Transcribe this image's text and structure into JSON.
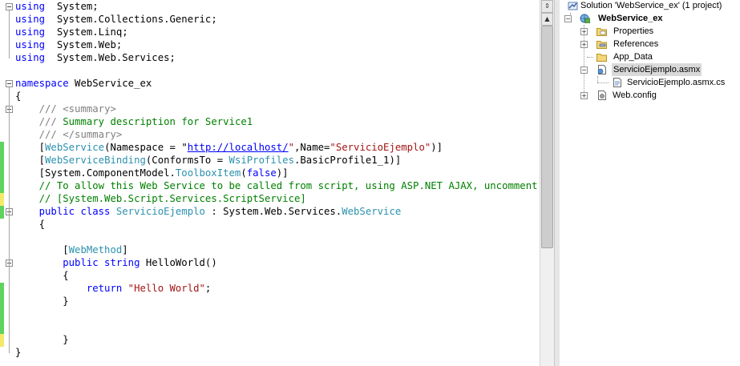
{
  "editor": {
    "lines": [
      [
        [
          "kw",
          "using"
        ],
        [
          "",
          "  System;"
        ]
      ],
      [
        [
          "kw",
          "using"
        ],
        [
          "",
          "  System.Collections.Generic;"
        ]
      ],
      [
        [
          "kw",
          "using"
        ],
        [
          "",
          "  System.Linq;"
        ]
      ],
      [
        [
          "kw",
          "using"
        ],
        [
          "",
          "  System.Web;"
        ]
      ],
      [
        [
          "kw",
          "using"
        ],
        [
          "",
          "  System.Web.Services;"
        ]
      ],
      [],
      [
        [
          "kw",
          "namespace"
        ],
        [
          "",
          " WebService_ex"
        ]
      ],
      [
        [
          "",
          "{"
        ]
      ],
      [
        [
          "",
          "    "
        ],
        [
          "cg",
          "///"
        ],
        [
          "cm",
          " "
        ],
        [
          "cg",
          "<summary>"
        ]
      ],
      [
        [
          "",
          "    "
        ],
        [
          "cg",
          "///"
        ],
        [
          "cm",
          " Summary description for Service1"
        ]
      ],
      [
        [
          "",
          "    "
        ],
        [
          "cg",
          "///"
        ],
        [
          "cm",
          " "
        ],
        [
          "cg",
          "</summary>"
        ]
      ],
      [
        [
          "",
          "    ["
        ],
        [
          "ty",
          "WebService"
        ],
        [
          "",
          "(Namespace = \""
        ],
        [
          "ul",
          "http://localhost/"
        ],
        [
          "st",
          "\""
        ],
        [
          "",
          ",Name="
        ],
        [
          "st",
          "\"ServicioEjemplo\""
        ],
        [
          "",
          ")]"
        ]
      ],
      [
        [
          "",
          "    ["
        ],
        [
          "ty",
          "WebServiceBinding"
        ],
        [
          "",
          "(ConformsTo = "
        ],
        [
          "ty",
          "WsiProfiles"
        ],
        [
          "",
          ".BasicProfile1_1)]"
        ]
      ],
      [
        [
          "",
          "    [System.ComponentModel."
        ],
        [
          "ty",
          "ToolboxItem"
        ],
        [
          "",
          "("
        ],
        [
          "kw",
          "false"
        ],
        [
          "",
          ")]"
        ]
      ],
      [
        [
          "",
          "    "
        ],
        [
          "cm",
          "// To allow this Web Service to be called from script, using ASP.NET AJAX, uncomment the f"
        ]
      ],
      [
        [
          "",
          "    "
        ],
        [
          "cm",
          "// [System.Web.Script.Services.ScriptService]"
        ]
      ],
      [
        [
          "",
          "    "
        ],
        [
          "kw",
          "public class"
        ],
        [
          "",
          " "
        ],
        [
          "ty",
          "ServicioEjemplo"
        ],
        [
          "",
          " : System.Web.Services."
        ],
        [
          "ty",
          "WebService"
        ]
      ],
      [
        [
          "",
          "    {"
        ]
      ],
      [],
      [
        [
          "",
          "        ["
        ],
        [
          "ty",
          "WebMethod"
        ],
        [
          "",
          "]"
        ]
      ],
      [
        [
          "",
          "        "
        ],
        [
          "kw",
          "public string"
        ],
        [
          "",
          " HelloWorld()"
        ]
      ],
      [
        [
          "",
          "        {"
        ]
      ],
      [
        [
          "",
          "            "
        ],
        [
          "kw",
          "return"
        ],
        [
          "",
          " "
        ],
        [
          "st",
          "\"Hello World\""
        ],
        [
          "",
          ";"
        ]
      ],
      [
        [
          "",
          "        }"
        ]
      ],
      [],
      [],
      [
        [
          "",
          "        }"
        ]
      ],
      [
        [
          "",
          "}"
        ]
      ]
    ]
  },
  "solution_explorer": {
    "solution_label": "Solution 'WebService_ex' (1 project)",
    "project_label": "WebService_ex",
    "items": [
      {
        "label": "Properties",
        "icon": "properties-folder-icon"
      },
      {
        "label": "References",
        "icon": "references-folder-icon"
      },
      {
        "label": "App_Data",
        "icon": "folder-icon"
      },
      {
        "label": "ServicioEjemplo.asmx",
        "icon": "asmx-file-icon"
      },
      {
        "label": "ServicioEjemplo.asmx.cs",
        "icon": "cs-file-icon"
      },
      {
        "label": "Web.config",
        "icon": "config-file-icon"
      }
    ]
  },
  "colors": {
    "keyword": "#0000ff",
    "type": "#2b91af",
    "string": "#a31515",
    "comment": "#008000",
    "gutter_changed": "#5ed35e",
    "gutter_unsaved": "#f4e96a"
  }
}
